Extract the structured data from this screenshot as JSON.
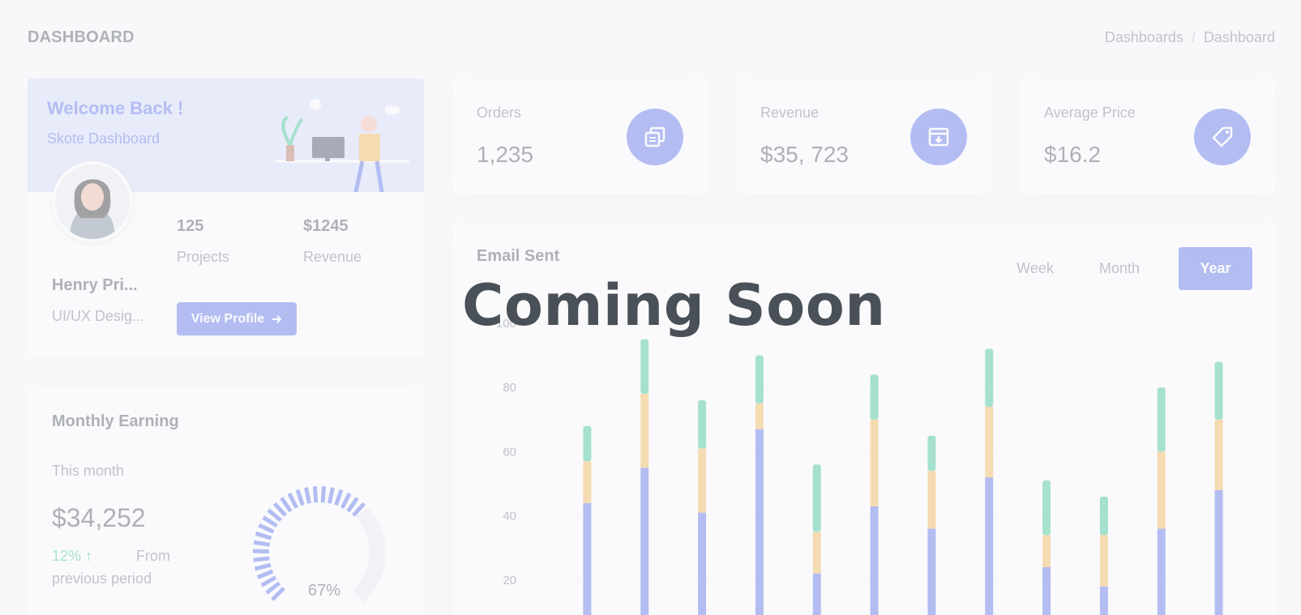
{
  "header": {
    "title": "DASHBOARD",
    "breadcrumb": [
      "Dashboards",
      "/",
      "Dashboard"
    ]
  },
  "welcome": {
    "title": "Welcome Back !",
    "subtitle": "Skote Dashboard",
    "profile_name": "Henry Pri...",
    "profile_role": "UI/UX Desig...",
    "projects_value": "125",
    "projects_label": "Projects",
    "revenue_value": "$1245",
    "revenue_label": "Revenue",
    "button_label": "View Profile"
  },
  "stats": [
    {
      "label": "Orders",
      "value": "1,235",
      "icon": "copy-icon"
    },
    {
      "label": "Revenue",
      "value": "$35, 723",
      "icon": "archive-icon"
    },
    {
      "label": "Average Price",
      "value": "$16.2",
      "icon": "tag-icon"
    }
  ],
  "earning": {
    "title": "Monthly Earning",
    "subtitle": "This month",
    "value": "$34,252",
    "delta": "12%",
    "delta_suffix": "From",
    "delta_suffix2": "previous period",
    "gauge_percent": 67,
    "gauge_label": "67%"
  },
  "email": {
    "title": "Email Sent",
    "tabs": [
      "Week",
      "Month",
      "Year"
    ],
    "active_tab": "Year"
  },
  "overlay": {
    "text": "Coming Soon"
  },
  "colors": {
    "primary": "#556ee6",
    "warning": "#f1b44c",
    "success": "#34c38f"
  },
  "chart_data": {
    "type": "bar",
    "stacked": true,
    "y_ticks": [
      20,
      40,
      60,
      80,
      100
    ],
    "ylim": [
      0,
      100
    ],
    "series": [
      {
        "color": "#556ee6",
        "values": [
          44,
          55,
          41,
          67,
          22,
          43,
          36,
          52,
          24,
          18,
          36,
          48
        ]
      },
      {
        "color": "#f1b44c",
        "values": [
          13,
          23,
          20,
          8,
          13,
          27,
          18,
          22,
          10,
          16,
          24,
          22
        ]
      },
      {
        "color": "#34c38f",
        "values": [
          11,
          17,
          15,
          15,
          21,
          14,
          11,
          18,
          17,
          12,
          20,
          18
        ]
      }
    ]
  }
}
